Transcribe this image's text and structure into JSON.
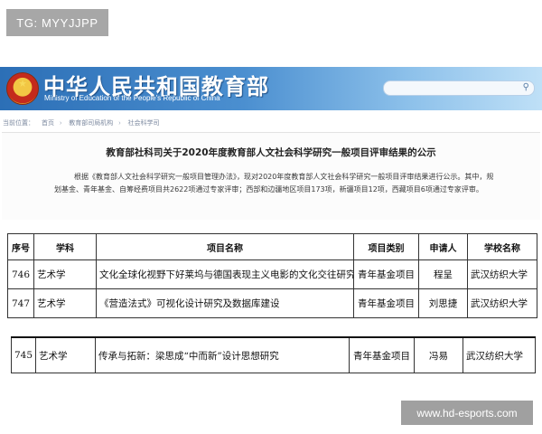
{
  "tag": {
    "text": "TG: MYYJJPP"
  },
  "banner": {
    "title": "中华人民共和国教育部",
    "subtitle": "Ministry of Education of the People's Republic of China",
    "search_placeholder": ""
  },
  "breadcrumb": {
    "label": "当前位置：",
    "items": [
      "首页",
      "教育部司局机构",
      "社会科学司"
    ]
  },
  "notice": {
    "title": "教育部社科司关于2020年度教育部人文社会科学研究一般项目评审结果的公示",
    "body": "根据《教育部人文社会科学研究一般项目管理办法》，现对2020年度教育部人文社会科学研究一般项目评审结果进行公示。其中，规划基金、青年基金、自筹经费项目共2622项通过专家评审；西部和边疆地区项目173项，新疆项目12项，西藏项目6项通过专家评审。"
  },
  "table": {
    "headers": [
      "序号",
      "学科",
      "项目名称",
      "项目类别",
      "申请人",
      "学校名称"
    ],
    "rows": [
      [
        "746",
        "艺术学",
        "文化全球化视野下好莱坞与德国表现主义电影的文化交往研究",
        "青年基金项目",
        "程呈",
        "武汉纺织大学"
      ],
      [
        "747",
        "艺术学",
        "《营造法式》可视化设计研究及数据库建设",
        "青年基金项目",
        "刘思捷",
        "武汉纺织大学"
      ]
    ]
  },
  "table2": {
    "rows": [
      [
        "745",
        "艺术学",
        "传承与拓新：梁思成“中而新”设计思想研究",
        "青年基金项目",
        "冯易",
        "武汉纺织大学"
      ]
    ]
  },
  "watermark": {
    "text": "www.hd-esports.com"
  }
}
